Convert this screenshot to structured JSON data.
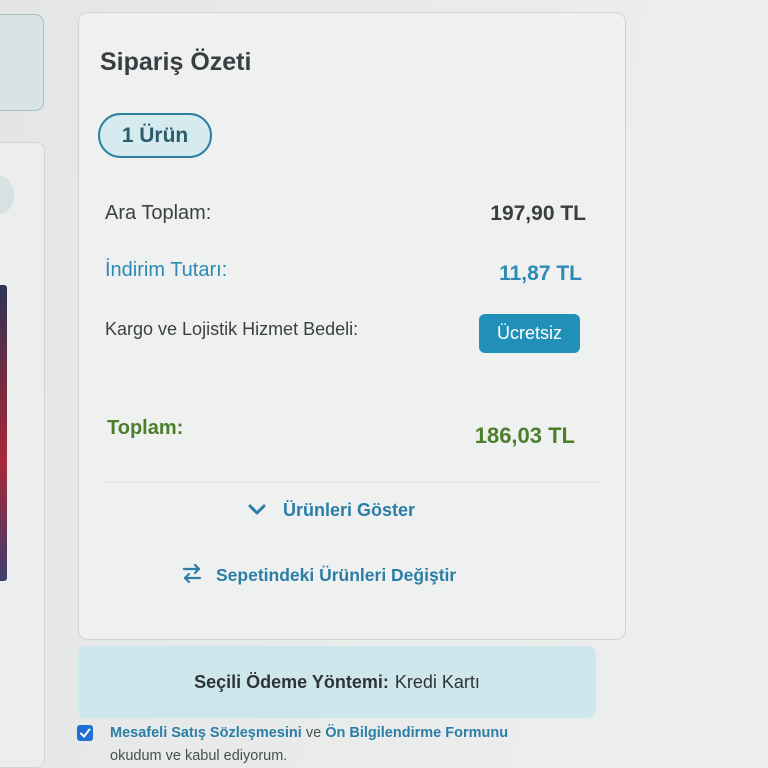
{
  "summary": {
    "title": "Sipariş Özeti",
    "item_count_badge": "1 Ürün",
    "subtotal": {
      "label": "Ara Toplam:",
      "value": "197,90 TL"
    },
    "discount": {
      "label": "İndirim Tutarı:",
      "value": "11,87 TL"
    },
    "shipping": {
      "label": "Kargo ve Lojistik Hizmet Bedeli:",
      "value": "Ücretsiz"
    },
    "total": {
      "label": "Toplam:",
      "value": "186,03 TL"
    },
    "show_products_link": "Ürünleri Göster",
    "change_products_link": "Sepetindeki Ürünleri Değiştir"
  },
  "payment": {
    "label": "Seçili Ödeme Yöntemi:",
    "value": "Kredi Kartı"
  },
  "agreement": {
    "checked": true,
    "link_contract": "Mesafeli Satış Sözleşmesini",
    "connector": "ve",
    "link_form": "Ön Bilgilendirme Formunu",
    "suffix": "okudum ve kabul ediyorum."
  },
  "icons": {
    "show_products": "chevron-down-icon",
    "change_products": "swap-arrows-icon",
    "checkbox": "checkmark-icon"
  },
  "colors": {
    "accent_teal": "#2b7ea6",
    "discount": "#2c8ab5",
    "total_green": "#4c7f2b",
    "free_badge": "#2190b8",
    "payment_box": "#cee7ed",
    "checkbox": "#1f6fd4"
  }
}
